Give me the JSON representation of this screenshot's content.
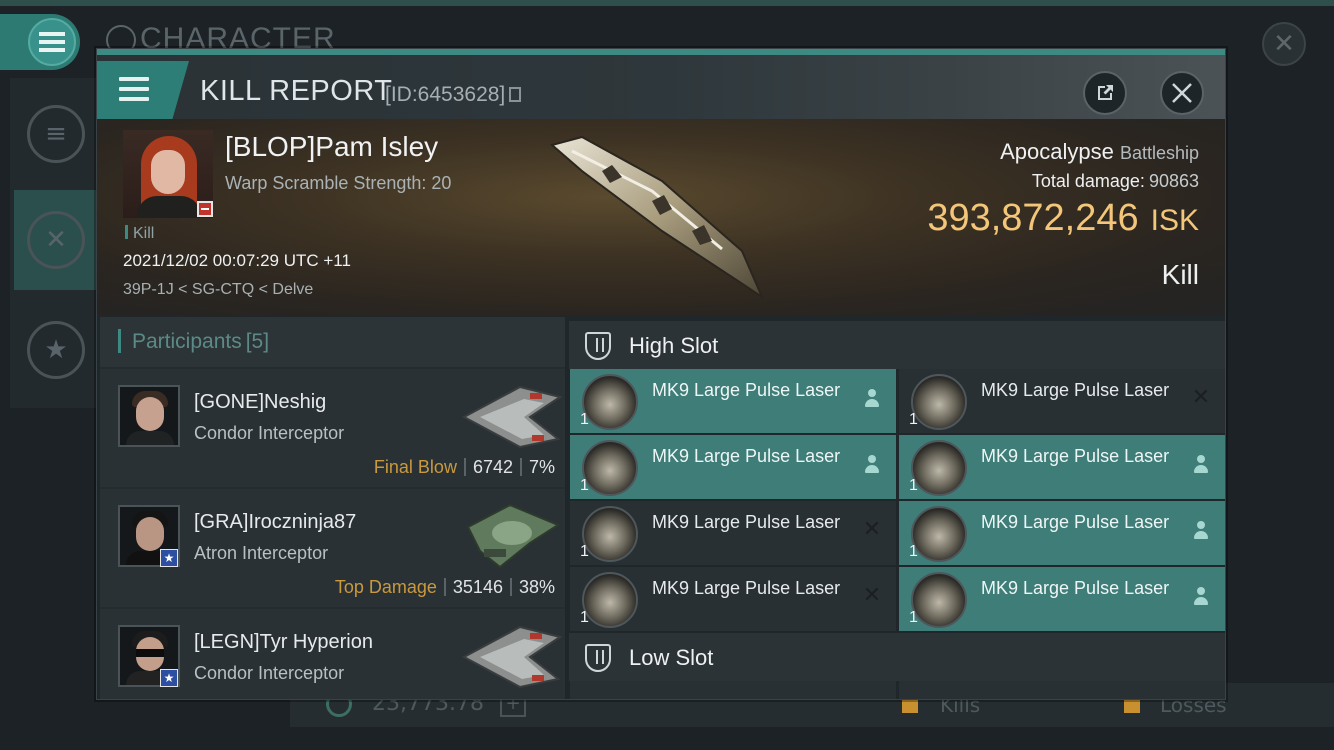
{
  "background": {
    "screen_title": "CHARACTER",
    "bottom_value": "23,773.78",
    "kills_label": "Kills",
    "losses_label": "Losses"
  },
  "window": {
    "title": "KILL REPORT",
    "report_id": "[ID:6453628]"
  },
  "victim": {
    "name": "[BLOP]Pam Isley",
    "warp_scramble": "Warp Scramble Strength: 20",
    "tag": "Kill",
    "datetime": "2021/12/02 00:07:29 UTC +11",
    "location": "39P-1J < SG-CTQ < Delve",
    "ship": "Apocalypse",
    "ship_class": "Battleship",
    "total_damage_label": "Total damage:",
    "total_damage": "90863",
    "isk_value": "393,872,246",
    "isk_unit": "ISK",
    "result": "Kill"
  },
  "participants": {
    "title": "Participants",
    "count": "[5]",
    "items": [
      {
        "name": "[GONE]Neshig",
        "ship": "Condor Interceptor",
        "role": "Final Blow",
        "damage": "6742",
        "percent": "7%"
      },
      {
        "name": "[GRA]Iroczninja87",
        "ship": "Atron Interceptor",
        "role": "Top Damage",
        "damage": "35146",
        "percent": "38%"
      },
      {
        "name": "[LEGN]Tyr Hyperion",
        "ship": "Condor Interceptor",
        "role": "",
        "damage": "",
        "percent": ""
      }
    ]
  },
  "high_slot": {
    "title": "High Slot",
    "modules": [
      {
        "name": "MK9 Large Pulse Laser",
        "qty": "1",
        "status": "dropped-online"
      },
      {
        "name": "MK9 Large Pulse Laser",
        "qty": "1",
        "status": "destroyed"
      },
      {
        "name": "MK9 Large Pulse Laser",
        "qty": "1",
        "status": "dropped-online"
      },
      {
        "name": "MK9 Large Pulse Laser",
        "qty": "1",
        "status": "dropped-online"
      },
      {
        "name": "MK9 Large Pulse Laser",
        "qty": "1",
        "status": "destroyed"
      },
      {
        "name": "MK9 Large Pulse Laser",
        "qty": "1",
        "status": "dropped-online"
      },
      {
        "name": "MK9 Large Pulse Laser",
        "qty": "1",
        "status": "destroyed"
      },
      {
        "name": "MK9 Large Pulse Laser",
        "qty": "1",
        "status": "dropped-online"
      }
    ]
  },
  "low_slot": {
    "title": "Low Slot"
  },
  "colors": {
    "accent": "#3d8a83",
    "isk": "#f3c679",
    "role": "#c9993d",
    "online_row": "#3e7d78"
  }
}
